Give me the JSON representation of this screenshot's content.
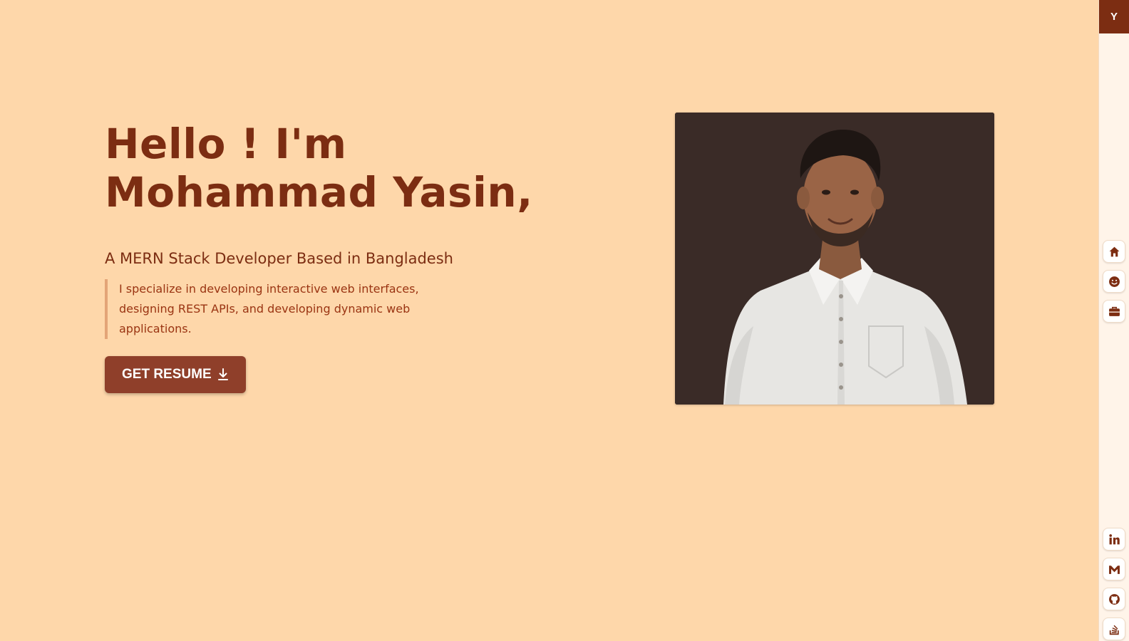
{
  "brand": {
    "logo_letter": "Y"
  },
  "hero": {
    "title_line1": "Hello ! I'm",
    "title_line2": "Mohammad Yasin,",
    "subtitle": "A MERN Stack Developer Based in Bangladesh",
    "description": "I specialize in developing interactive web interfaces, designing REST APIs, and developing dynamic web applications.",
    "resume_button_label": "GET RESUME"
  },
  "sidebar": {
    "nav_icons": [
      "home-icon",
      "smile-icon",
      "briefcase-icon"
    ],
    "social_icons": [
      "linkedin-icon",
      "gmail-icon",
      "github-icon",
      "stackoverflow-icon"
    ]
  },
  "colors": {
    "background": "#fed7aa",
    "accent": "#7c2d12",
    "button": "#8f3f2a",
    "photo_background": "#3a2b27",
    "sidebar": "#fff4e9"
  }
}
